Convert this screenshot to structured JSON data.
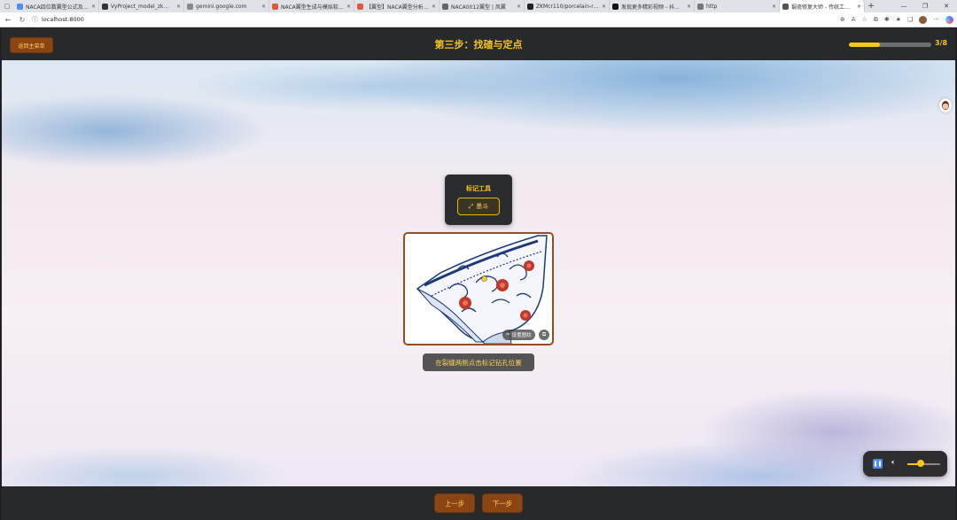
{
  "browser": {
    "tabs": [
      {
        "title": "NACA四位数翼型公式及代码 -",
        "fav": "#4f8cf7"
      },
      {
        "title": "VyProject_model_zkm1/model...",
        "fav": "#333333"
      },
      {
        "title": "gemini.google.com",
        "fav": "#888888"
      },
      {
        "title": "NACA翼型生成与模拟软件工具...",
        "fav": "#e0573c"
      },
      {
        "title": "【翼型】NACA翼型分析【含Ma...",
        "fav": "#e0573c"
      },
      {
        "title": "NACA0012翼型 | 风翼",
        "fav": "#666666"
      },
      {
        "title": "ZKMcr110/porcelain-restoratio...",
        "fav": "#222222"
      },
      {
        "title": "发现更多精彩视频 - 抖音搜索",
        "fav": "#111111"
      },
      {
        "title": "http",
        "fav": "#777777"
      },
      {
        "title": "锔瓷修复大师 - 传统工艺...",
        "fav": "#555555",
        "active": true
      }
    ],
    "url": "localhost:8000"
  },
  "app": {
    "back_menu_label": "返回主菜单",
    "step_title": "第三步：找碴与定点",
    "progress_text": "3/8",
    "progress_fraction": 0.375,
    "tool_panel_title": "标记工具",
    "tool_button_label": "墨斗",
    "tool_button_icon": "ink-line-icon",
    "image_chip_label": "设置图纹",
    "hint": "在裂缝两侧点击标记钻孔位置",
    "prev_label": "上一步",
    "next_label": "下一步",
    "audio_volume": 0.4,
    "colors": {
      "accent": "#f6c31c",
      "button_bg": "#8b4513",
      "bar_bg": "#27292b",
      "frame_border": "#9b4b1c"
    }
  }
}
